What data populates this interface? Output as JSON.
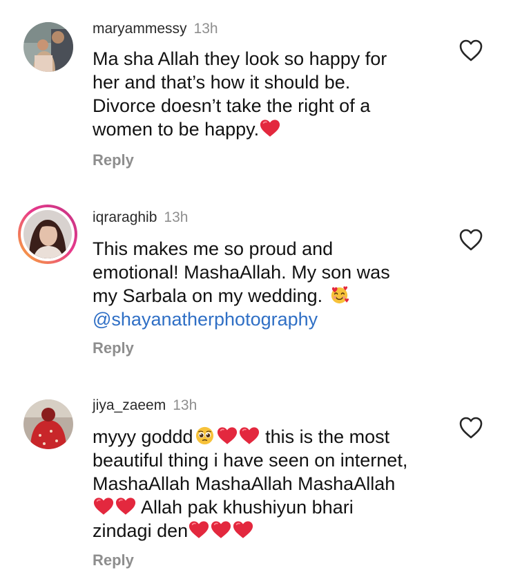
{
  "comments": [
    {
      "username": "maryammessy",
      "time": "13h",
      "text": "Ma sha Allah they look so happy for\nher and that’s how it should be.\nDivorce doesn’t take the right of a\nwomen to be happy.",
      "reply": "Reply"
    },
    {
      "username": "iqraraghib",
      "time": "13h",
      "text": "This makes me so proud and\nemotional! MashaAllah. My son was\nmy Sarbala on my wedding. ",
      "mention": "@shayanatherphotography",
      "reply": "Reply"
    },
    {
      "username": "jiya_zaeem",
      "time": "13h",
      "line1a": "myyy goddd",
      "line1b": " this is the most",
      "line2": "beautiful thing i have seen on internet,",
      "line3": "MashaAllah MashaAllah MashaAllah",
      "line4": " Allah pak khushiyun bhari",
      "line5": "zindagi den",
      "reply": "Reply"
    }
  ],
  "colors": {
    "text": "#121212",
    "muted": "#8e8e8e",
    "mention": "#2f6fc5",
    "heart_emoji": "#e3283e"
  },
  "icons": [
    "like-heart-icon",
    "red-heart-emoji",
    "smiling-face-with-hearts-emoji",
    "pleading-face-emoji"
  ]
}
